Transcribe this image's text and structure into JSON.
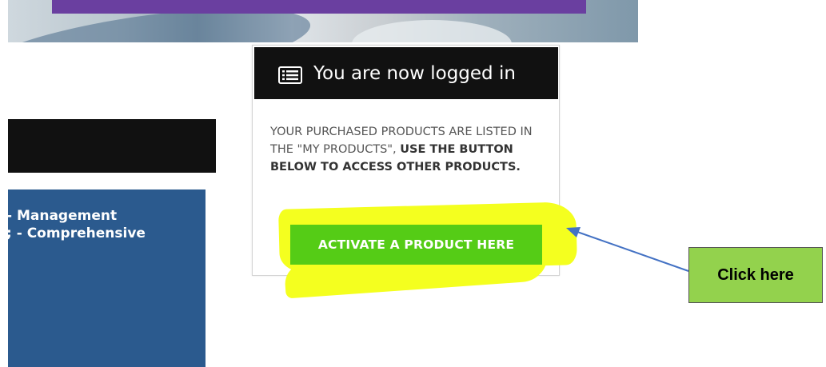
{
  "login_card": {
    "title": "You are now logged in",
    "icon": "list-icon",
    "message_normal": "YOUR PURCHASED PRODUCTS ARE LISTED IN THE \"MY PRODUCTS\", ",
    "message_bold": "USE THE BUTTON BELOW TO ACCESS OTHER PRODUCTS.",
    "button_label": "ACTIVATE A PRODUCT HERE"
  },
  "course_panel": {
    "line1": "- Management",
    "line2": "; - Comprehensive"
  },
  "annotation": {
    "callout_label": "Click here"
  },
  "colors": {
    "button": "#55cc16",
    "highlight": "#f4ff1f",
    "callout": "#93d24d",
    "arrow": "#4472c4",
    "panel_blue": "#2b5a8e",
    "header_black": "#111111",
    "banner_stripe": "#6a3fa0"
  }
}
